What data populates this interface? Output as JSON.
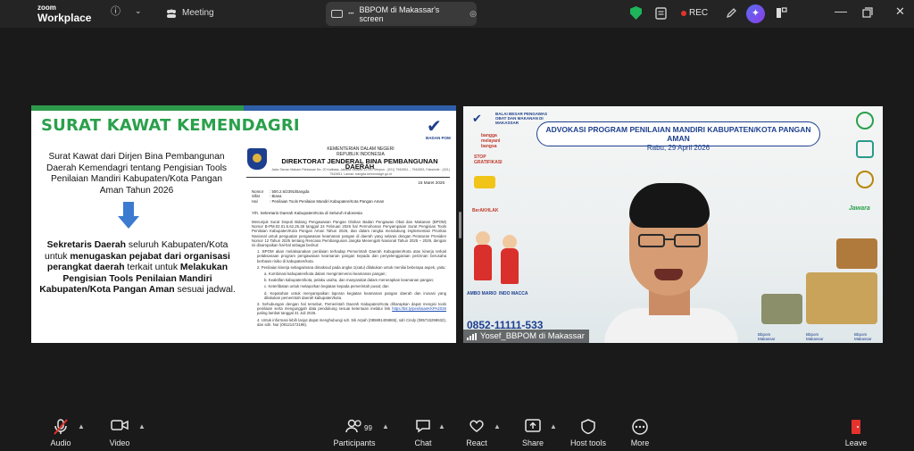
{
  "app": {
    "brand_line1": "zoom",
    "brand_line2": "Workplace"
  },
  "topbar": {
    "meeting_label": "Meeting",
    "share_title": "BBPOM di Makassar's screen",
    "rec_label": "REC",
    "icons": [
      "info-icon",
      "chevron-down-icon",
      "participants-icon",
      "monitor-icon",
      "more-icon",
      "shield-check-icon",
      "notes-icon",
      "record-dot-icon",
      "edit-icon",
      "ai-companion-icon",
      "split-view-icon",
      "minimize-icon",
      "maximize-icon",
      "close-icon"
    ]
  },
  "slide": {
    "title": "SURAT KAWAT KEMENDAGRI",
    "bpom_label": "BADAN POM",
    "left_text": "Surat Kawat dari Dirjen Bina Pembangunan Daerah Kemendagri tentang Pengisian Tools Penilaian Mandiri Kabupaten/Kota Pangan Aman Tahun 2026",
    "bold_part1": "Sekretaris Daerah",
    "bold_part2": " seluruh Kabupaten/Kota untuk ",
    "bold_part3": "menugaskan pejabat dari organisasi perangkat daerah",
    "bold_part4": " terkait untuk ",
    "bold_part5": "Melakukan Pengisian Tools Penilaian Mandiri Kabupaten/Kota Pangan Aman",
    "bold_part6": " sesuai jadwal.",
    "doc": {
      "h1": "KEMENTERIAN DALAM NEGERI",
      "h2": "REPUBLIK INDONESIA",
      "h3": "DIREKTORAT JENDERAL BINA PEMBANGUNAN DAERAH",
      "h4": "Jalan Taman Makam Pahlawan No. 20 Kalibata, Jakarta Selatan 12750 Telepon : (021) 7942651 – 7942653, Faksimile : (021) 7942651, Laman: bangda.kemendagri.go.id",
      "date": "16 Maret 2026",
      "nomor_k": "Nomor",
      "nomor_v": ": 500.2.6/2391/Bangda",
      "sifat_k": "Sifat",
      "sifat_v": ": Biasa",
      "hal_k": "Hal",
      "hal_v": ": Penilaian Tools Penilaian Mandiri Kabupaten/Kota Pangan Aman",
      "yth": "Yth. Sekretaris Daerah Kabupaten/Kota di Seluruh Indonesia",
      "p1": "Menunjuk Surat Deputi Bidang Pengawasan Pangan Olahan Badan Pengawas Obat dan Makanan (BPOM) Nomor B-PM.02.01.5.62.26.38 tanggal 24 Februari 2026 hal Permohonan Penyampaian Surat Pengisian Tools Penilaian Kabupaten/Kota Pangan Aman Tahun 2026, dan dalam rangka mendukung implementasi Prioritas Nasional untuk penguatan pengawasan keamanan pangan di daerah yang selaras dengan Peraturan Presiden Nomor 12 Tahun 2025 tentang Rencana Pembangunan Jangka Menengah Nasional Tahun 2025 – 2029, dengan ini disampaikan hal-hal sebagai berikut:",
      "p2": "1. BPOM akan melaksanakan penilaian terhadap Pemerintah Daerah Kabupaten/Kota atas kinerja terkait pelaksanaan program pengawasan keamanan pangan kepada dan penyelenggaraan perizinan berusaha berbasis risiko di kabupaten/kota.",
      "p3": "2. Penilaian kinerja sebagaimana dimaksud pada angka 1(satu) dilakukan untuk menilai beberapa aspek, yaitu:",
      "a": "a. Kombinasi kabupaten/kota dalam mengintervensi keamanan pangan;",
      "b": "b. Keaktifan kabupaten/kota, pelaku usaha, dan masyarakat dalam menerapkan keamanan pangan;",
      "c": "c. Keterlibatan untuk melaporkan kegiatan kepada pemerintah pusat; dan",
      "d": "d. Kepatuhan untuk menyampaikan laporan kegiatan keamanan pangan daerah dan inovasi yang dilakukan pemerintah daerah kabupaten/kota.",
      "p4": "3. Sehubungan dengan hal tersebut, Pemerintah Daerah Kabupaten/Kota diharapkan dapat mengisi tools penilaian serta mengunggah data pendukung sesuai ketentuan melalui link ",
      "link": "https://bit.ly/penilaianKKPA2026",
      "p4b": " paling lambat tanggal 31 Juli 2026.",
      "p5": "4. Untuk informasi lebih lanjut dapat menghubungi sdr. Siti Arpah (085891406865), sdri Cindy (085715298632), dan sdri. Nur (08121472196)."
    }
  },
  "video": {
    "top_logo_text": "BALAI BESAR PENGAWAS OBAT DAN MAKANAN DI MAKASSAR",
    "banner_title": "ADVOKASI PROGRAM PENILAIAN MANDIRI KABUPATEN/KOTA PANGAN AMAN",
    "banner_date": "Rabu, 29 April 2026",
    "side_bangga": "bangga melayani bangsa",
    "side_stop": "STOP GRATIFIKASI",
    "side_akhlak": "BerAKHLAK",
    "jawara": "Jawara",
    "kid_left": "AMBO MARIO",
    "kid_right": "INDO MACCA",
    "phone": "0852-11111-533",
    "footer_1": "Bbpom Makassar",
    "footer_2": "Bbpom Makassar",
    "footer_3": "Bbpom Makassar",
    "participant_name": "Yosef_BBPOM di Makassar"
  },
  "toolbar": {
    "audio": "Audio",
    "video": "Video",
    "participants": "Participants",
    "participants_count": "99",
    "chat": "Chat",
    "react": "React",
    "share": "Share",
    "host_tools": "Host tools",
    "more": "More",
    "leave": "Leave"
  },
  "colors": {
    "accent_green": "#2aa04b",
    "brand_blue": "#1d3f8f",
    "rec_red": "#e5322d",
    "leave_red": "#e5322d"
  }
}
